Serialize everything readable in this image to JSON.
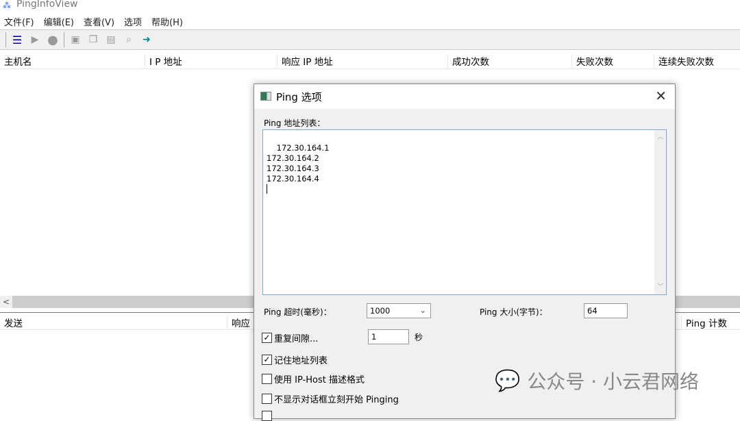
{
  "app": {
    "title": "PingInfoView"
  },
  "menu": [
    "文件(F)",
    "编辑(E)",
    "查看(V)",
    "选项",
    "帮助(H)"
  ],
  "toolbar": {
    "icons": [
      "options-icon",
      "start-icon",
      "stop-icon",
      "save-icon",
      "copy-icon",
      "properties-icon",
      "html-report-icon",
      "exit-icon"
    ]
  },
  "columns": [
    "主机名",
    "I P 地址",
    "响应 IP 地址",
    "成功次数",
    "失败次数",
    "连续失败次数"
  ],
  "lower_columns": [
    "发送",
    "响应",
    "Ping 计数"
  ],
  "dialog": {
    "title": "Ping 选项",
    "address_label": "Ping 地址列表：",
    "addresses": "172.30.164.1\n172.30.164.2\n172.30.164.3\n172.30.164.4\n",
    "timeout_label": "Ping 超时(毫秒)：",
    "timeout_value": "1000",
    "size_label": "Ping 大小(字节)：",
    "size_value": "64",
    "repeat_label": "重复间隙...",
    "repeat_value": "1",
    "repeat_unit": "秒",
    "remember_label": "记住地址列表",
    "iphost_label": "使用 IP-Host 描述格式",
    "nodialog_label": "不显示对话框立刻开始 Pinging"
  },
  "watermark": "公众号 · 小云君网络"
}
